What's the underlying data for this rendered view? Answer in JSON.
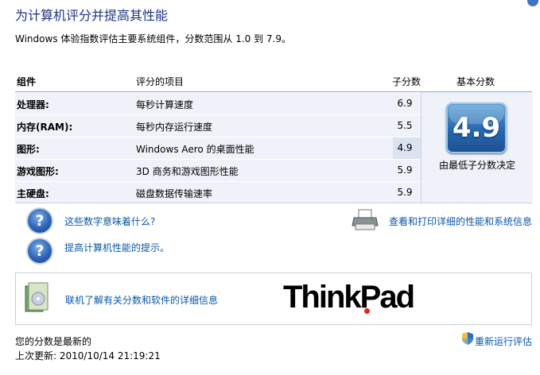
{
  "header": {
    "title": "为计算机评分并提高其性能",
    "subtitle": "Windows 体验指数评估主要系统组件，分数范围从 1.0 到 7.9。"
  },
  "table": {
    "columns": [
      "组件",
      "评分的项目",
      "子分数",
      "基本分数"
    ],
    "rows": [
      {
        "component": "处理器:",
        "item": "每秒计算速度",
        "subscore": "6.9"
      },
      {
        "component": "内存(RAM):",
        "item": "每秒内存运行速度",
        "subscore": "5.5"
      },
      {
        "component": "图形:",
        "item": "Windows Aero 的桌面性能",
        "subscore": "4.9"
      },
      {
        "component": "游戏图形:",
        "item": "3D 商务和游戏图形性能",
        "subscore": "5.9"
      },
      {
        "component": "主硬盘:",
        "item": "磁盘数据传输速率",
        "subscore": "5.9"
      }
    ],
    "base_score": "4.9",
    "base_note": "由最低子分数决定"
  },
  "links": {
    "what_mean": "这些数字意味着什么?",
    "tips": "提高计算机性能的提示。",
    "print": "查看和打印详细的性能和系统信息",
    "online": "联机了解有关分数和软件的详细信息"
  },
  "brand": {
    "name": "ThinkPad",
    "dot_color": "#e1261c"
  },
  "status": {
    "current": "您的分数是最新的",
    "last_update": "上次更新: 2010/10/14 21:19:21",
    "rerun": "重新运行评估"
  },
  "colors": {
    "title": "#1e3287",
    "link": "#0b57a6",
    "row_bg": "#eff2f9",
    "tile": "#2568af"
  }
}
